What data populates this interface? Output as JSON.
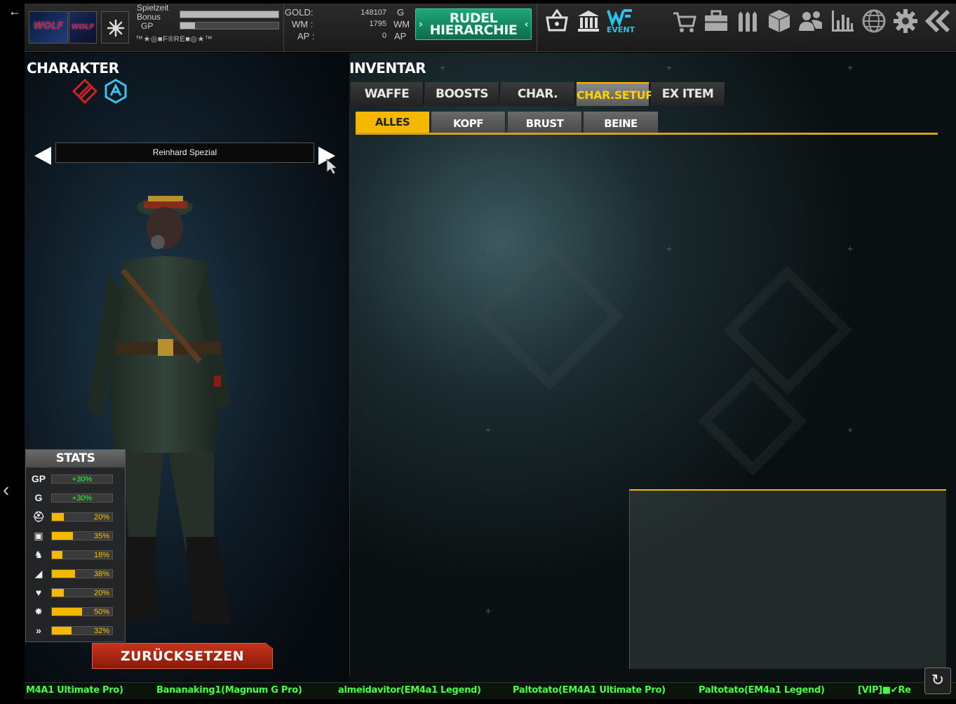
{
  "topbar": {
    "back_glyph": "←",
    "logo_text": "WOLF",
    "logo2_text": "WOLF",
    "labels": {
      "playtime": "Spielzeit",
      "bonus": "Bonus",
      "gp": "GP"
    },
    "playtime_fill": 1.0,
    "bonus_fill": 1.0,
    "gp_fill": 0.15,
    "player_name": "™★◎■F®RE■◎★™",
    "currency": [
      {
        "label": "GOLD:",
        "value": "148107",
        "unit": "G"
      },
      {
        "label": "WM :",
        "value": "1795",
        "unit": "WM"
      },
      {
        "label": "AP :",
        "value": "0",
        "unit": "AP"
      }
    ],
    "rudel_button": {
      "line1": "RUDEL",
      "line2": "HIERARCHIE"
    },
    "icons_left": [
      "basket-icon",
      "bank-icon",
      "event-icon"
    ],
    "event_label": "EVENT",
    "icons_right": [
      "cart-icon",
      "briefcase-icon",
      "ammo-icon",
      "box-icon",
      "friends-icon",
      "ranking-icon",
      "globe-icon",
      "settings-icon",
      "collapse-icon"
    ]
  },
  "character": {
    "title": "CHARAKTER",
    "name": "Reinhard Spezial",
    "stats_title": "STATS",
    "stats": [
      {
        "icon": "gp-icon",
        "glyph": "GP",
        "value": "+30%",
        "fill": 0,
        "bonus": true
      },
      {
        "icon": "gold-icon",
        "glyph": "G",
        "value": "+30%",
        "fill": 0,
        "bonus": true
      },
      {
        "icon": "helmet-icon",
        "glyph": "⛑",
        "value": "20%",
        "fill": 0.2,
        "bonus": false
      },
      {
        "icon": "armor-icon",
        "glyph": "▣",
        "value": "35%",
        "fill": 0.35,
        "bonus": false
      },
      {
        "icon": "wolf-icon",
        "glyph": "♞",
        "value": "18%",
        "fill": 0.18,
        "bonus": false
      },
      {
        "icon": "boot-icon",
        "glyph": "◢",
        "value": "38%",
        "fill": 0.38,
        "bonus": false
      },
      {
        "icon": "heart-icon",
        "glyph": "♥",
        "value": "20%",
        "fill": 0.2,
        "bonus": false
      },
      {
        "icon": "burst-icon",
        "glyph": "✸",
        "value": "50%",
        "fill": 0.5,
        "bonus": false
      },
      {
        "icon": "speed-icon",
        "glyph": "»",
        "value": "32%",
        "fill": 0.32,
        "bonus": false
      }
    ],
    "reset_label": "ZURÜCKSETZEN"
  },
  "inventory": {
    "title": "INVENTAR",
    "tabs": [
      {
        "label": "WAFFE",
        "active": false
      },
      {
        "label": "BOOSTS",
        "active": false
      },
      {
        "label": "CHAR.",
        "active": false
      },
      {
        "label": "CHAR.SETUP",
        "active": true
      },
      {
        "label": "EX ITEM",
        "active": false
      }
    ],
    "subtabs": [
      {
        "label": "ALLES",
        "active": true
      },
      {
        "label": "KOPF",
        "active": false
      },
      {
        "label": "BRUST",
        "active": false
      },
      {
        "label": "BEINE",
        "active": false
      }
    ]
  },
  "ticker": [
    "M4A1 Ultimate Pro)",
    "Bananaking1(Magnum G Pro)",
    "almeidavitor(EM4a1 Legend)",
    "Paltotato(EM4A1 Ultimate Pro)",
    "Paltotato(EM4a1 Legend)",
    "[VIP]■✔Re"
  ],
  "refresh_glyph": "↻",
  "side_chevron": "‹",
  "colors": {
    "accent": "#f5b800",
    "rudel": "#1fa67a",
    "reset": "#c8331c",
    "ticker": "#44ff44"
  }
}
